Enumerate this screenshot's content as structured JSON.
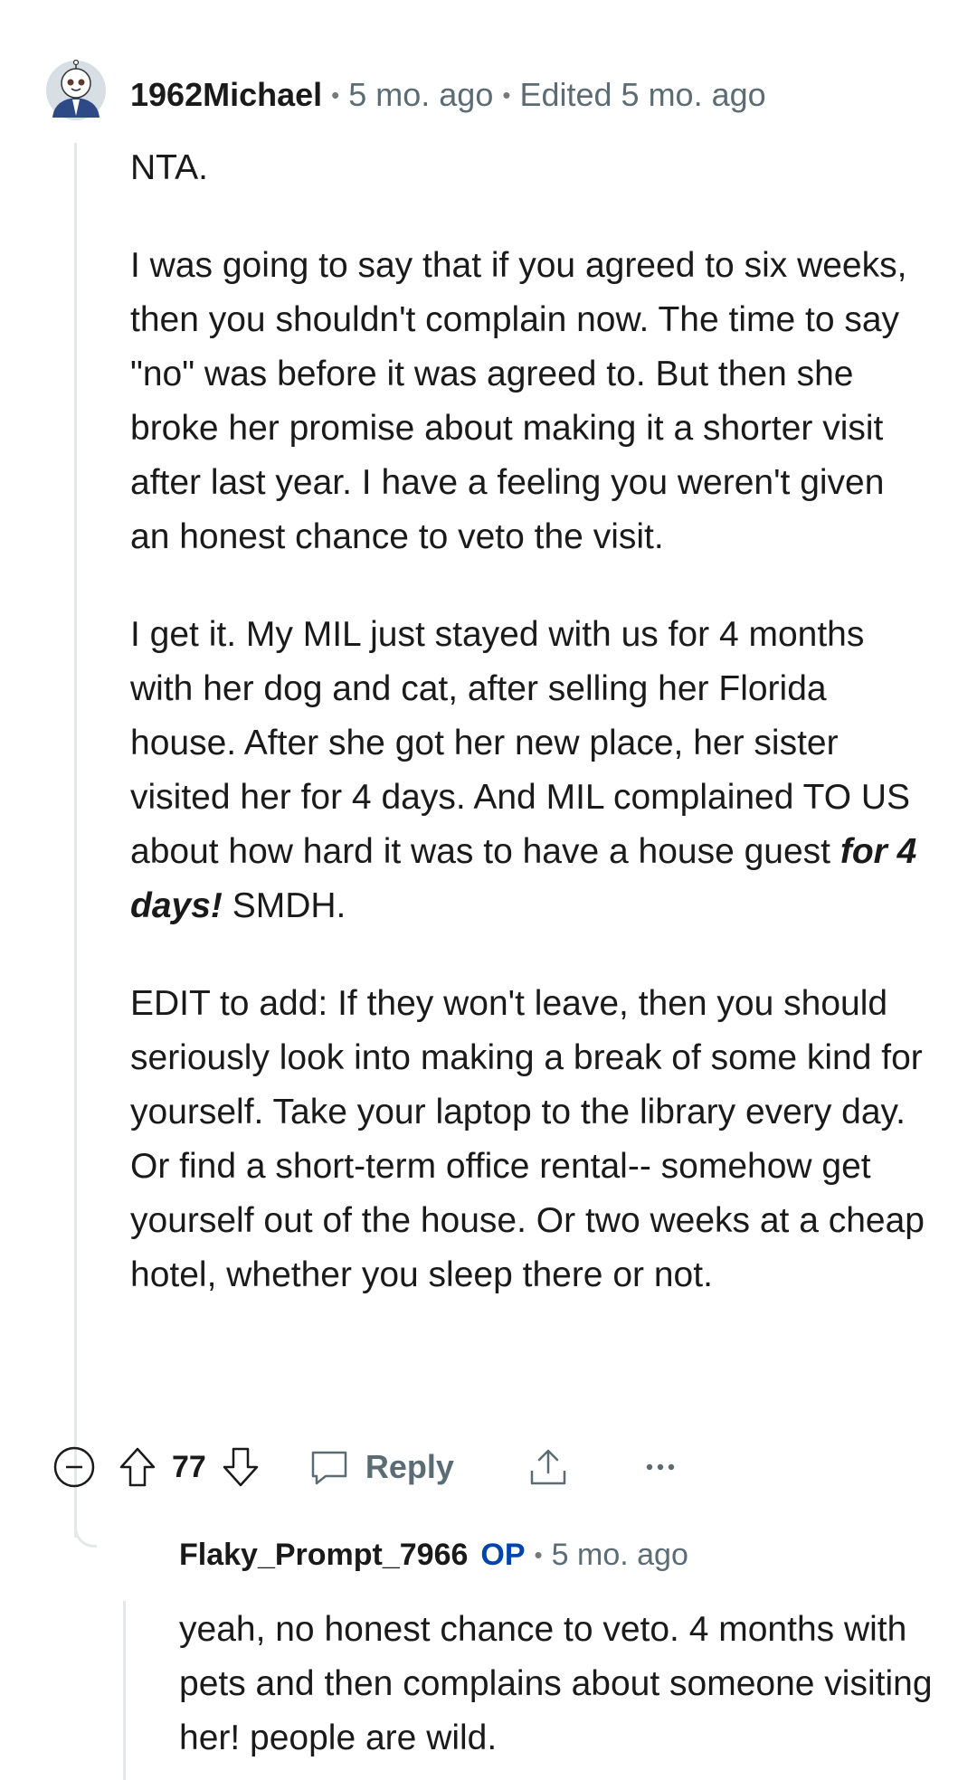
{
  "comment": {
    "author": "1962Michael",
    "time": "5 mo. ago",
    "edited": "Edited 5 mo. ago",
    "paragraphs": [
      "NTA.",
      "I was going to say that if you agreed to six weeks, then you shouldn't complain now. The time to say \"no\" was before it was agreed to. But then she broke her promise about making it a shorter visit after last year. I have a feeling you weren't given an honest chance to veto the visit.",
      "EDIT to add: If they won't leave, then you should seriously look into making a break of some kind for yourself. Take your laptop to the library every day. Or find a short-term office rental-- somehow get yourself out of the house. Or two weeks at a cheap hotel, whether you sleep there or not."
    ],
    "p3": {
      "before": "I get it. My MIL just stayed with us for 4 months with her dog and cat, after selling her Florida house. After she got her new place, her sister visited her for 4 days. And MIL complained TO US about how hard it was to have a house guest ",
      "emphasis": "for 4 days!",
      "after": " SMDH."
    },
    "votes": "77",
    "reply_label": "Reply",
    "icons": [
      "collapse-icon",
      "upvote-icon",
      "downvote-icon",
      "comment-icon",
      "share-icon",
      "more-icon"
    ]
  },
  "reply": {
    "author": "Flaky_Prompt_7966",
    "badge": "OP",
    "time": "5 mo. ago",
    "text": "yeah, no honest chance to veto. 4 months with pets and then complains about someone visiting her! people are wild."
  },
  "colors": {
    "text": "#1a1a1b",
    "muted": "#5c6c74",
    "op": "#0045ac",
    "thread": "#e5e7e9"
  }
}
